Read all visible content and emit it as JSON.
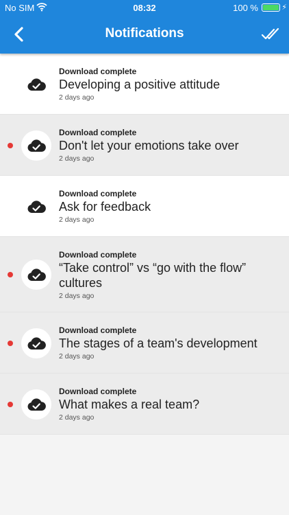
{
  "status_bar": {
    "carrier": "No SIM",
    "time": "08:32",
    "battery": "100 %"
  },
  "nav": {
    "title": "Notifications",
    "back_icon": "chevron-left-icon",
    "mark_all_icon": "double-check-icon"
  },
  "colors": {
    "nav_bar": "#1f86dc",
    "unread_dot": "#e53935",
    "unread_bg": "#ececec",
    "read_bg": "#ffffff"
  },
  "notifications": [
    {
      "label": "Download complete",
      "headline": "Developing a positive attitude",
      "time": "2 days ago",
      "unread": false,
      "icon": "cloud-check-icon"
    },
    {
      "label": "Download complete",
      "headline": "Don't let your emotions take over",
      "time": "2 days ago",
      "unread": true,
      "icon": "cloud-check-icon"
    },
    {
      "label": "Download complete",
      "headline": "Ask for feedback",
      "time": "2 days ago",
      "unread": false,
      "icon": "cloud-check-icon"
    },
    {
      "label": "Download complete",
      "headline": "“Take control” vs “go with the flow” cultures",
      "time": "2 days ago",
      "unread": true,
      "icon": "cloud-check-icon"
    },
    {
      "label": "Download complete",
      "headline": "The stages of a team's development",
      "time": "2 days ago",
      "unread": true,
      "icon": "cloud-check-icon"
    },
    {
      "label": "Download complete",
      "headline": "What makes a real team?",
      "time": "2 days ago",
      "unread": true,
      "icon": "cloud-check-icon"
    }
  ]
}
